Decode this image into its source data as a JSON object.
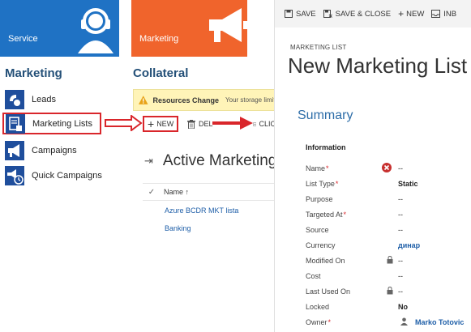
{
  "tiles": {
    "service": "Service",
    "marketing": "Marketing"
  },
  "sitemap": {
    "title": "Marketing",
    "items": [
      {
        "label": "Leads",
        "icon": "leads-icon"
      },
      {
        "label": "Marketing Lists",
        "icon": "marketing-lists-icon"
      },
      {
        "label": "Campaigns",
        "icon": "campaigns-icon"
      },
      {
        "label": "Quick Campaigns",
        "icon": "quick-campaigns-icon"
      }
    ]
  },
  "collateral": {
    "title": "Collateral",
    "notice_title": "Resources Change",
    "notice_text": "Your storage limit will be"
  },
  "commands": {
    "new": "NEW",
    "delete": "DEL",
    "click": "CLICKDIMI"
  },
  "view": {
    "title": "Active Marketing Li",
    "column": "Name",
    "rows": [
      "Azure BCDR MKT lista",
      "Banking"
    ]
  },
  "form": {
    "toolbar": {
      "save": "SAVE",
      "save_close": "SAVE & CLOSE",
      "new": "NEW",
      "inbox": "INB"
    },
    "entity_name": "MARKETING LIST",
    "record_title": "New Marketing List",
    "section": "Summary",
    "group": "Information",
    "fields": [
      {
        "label": "Name",
        "value": "--"
      },
      {
        "label": "List Type",
        "value": "Static"
      },
      {
        "label": "Purpose",
        "value": "--"
      },
      {
        "label": "Targeted At",
        "value": "--"
      },
      {
        "label": "Source",
        "value": "--"
      },
      {
        "label": "Currency",
        "value": "динар"
      },
      {
        "label": "Modified On",
        "value": "--"
      },
      {
        "label": "Cost",
        "value": "--"
      },
      {
        "label": "Last Used On",
        "value": "--"
      },
      {
        "label": "Locked",
        "value": "No"
      },
      {
        "label": "Owner",
        "value": "Marko Totovic"
      }
    ]
  },
  "colors": {
    "service_tile": "#1f72c4",
    "marketing_tile": "#f0642c",
    "highlight": "#d9262b",
    "link": "#1f5fa8",
    "heading": "#245078"
  }
}
